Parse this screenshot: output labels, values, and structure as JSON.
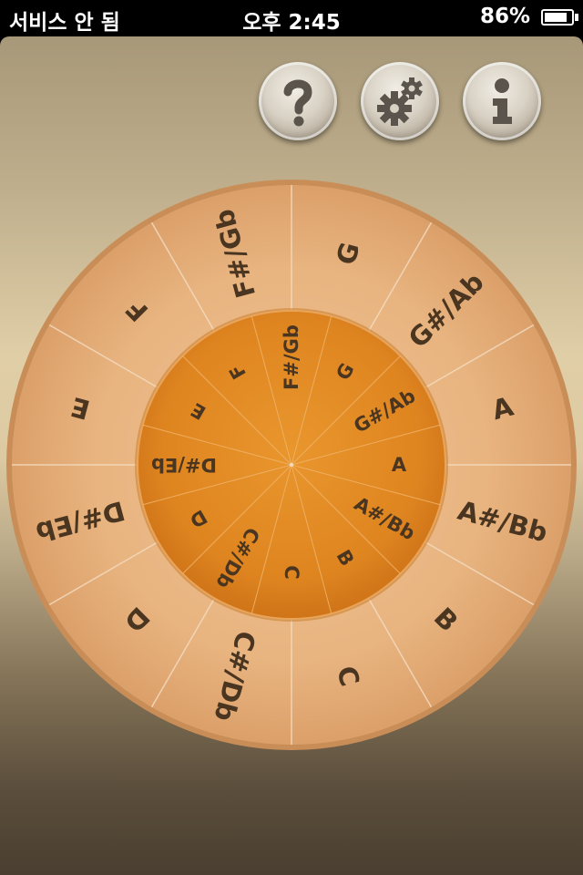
{
  "status_bar": {
    "carrier": "서비스 안 됨",
    "time": "오후 2:45",
    "battery": "86%",
    "battery_level": 0.86
  },
  "toolbar": {
    "help_icon": "question-mark-icon",
    "settings_icon": "gears-icon",
    "info_icon": "info-icon"
  },
  "wheel": {
    "outer_keys": [
      "G",
      "G#/Ab",
      "A",
      "A#/Bb",
      "B",
      "C",
      "C#/Db",
      "D",
      "D#/Eb",
      "E",
      "F",
      "F#/Gb"
    ],
    "inner_keys": [
      "G",
      "G#/Ab",
      "A",
      "A#/Bb",
      "B",
      "C",
      "C#/Db",
      "D",
      "D#/Eb",
      "E",
      "F",
      "F#/Gb"
    ],
    "colors": {
      "outer_ring": "#e7b27d",
      "inner_disc": "#e0861f",
      "label": "#4a3520",
      "divider": "#f3dcc0"
    }
  }
}
